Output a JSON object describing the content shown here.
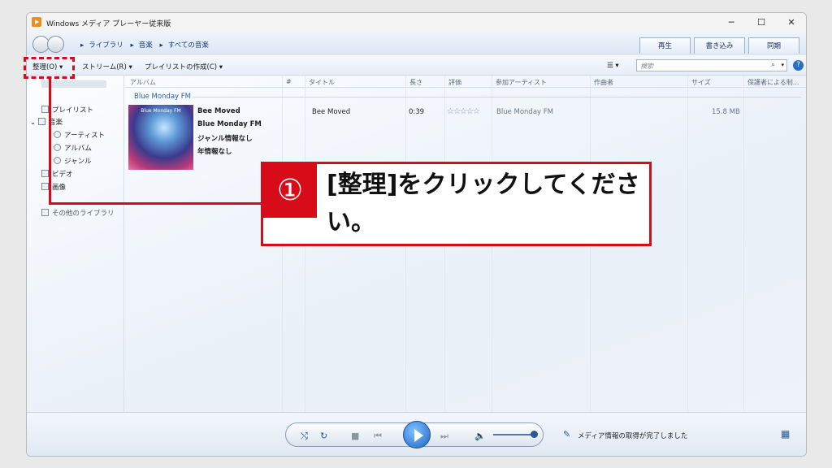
{
  "window": {
    "title": "Windows メディア プレーヤー従来版",
    "minimize": "─",
    "maximize": "☐",
    "close": "✕"
  },
  "breadcrumb": [
    "ライブラリ",
    "音楽",
    "すべての音楽"
  ],
  "tabs": [
    "再生",
    "書き込み",
    "同期"
  ],
  "toolbar": {
    "organize": "整理(O)",
    "stream": "ストリーム(R)",
    "create_playlist": "プレイリストの作成(C)",
    "search_placeholder": "検索"
  },
  "nav": {
    "playlists": "プレイリスト",
    "music": "音楽",
    "artist": "アーティスト",
    "album": "アルバム",
    "genre": "ジャンル",
    "video": "ビデオ",
    "pictures": "画像",
    "other_libraries": "その他のライブラリ"
  },
  "columns": [
    "アルバム",
    "#",
    "タイトル",
    "長さ",
    "評価",
    "参加アーティスト",
    "作曲者",
    "サイズ",
    "保護者による制..."
  ],
  "group": "Blue Monday FM",
  "album": {
    "art_text": "Blue Monday FM",
    "title": "Bee Moved",
    "artist": "Blue Monday FM",
    "genre": "ジャンル情報なし",
    "year": "年情報なし"
  },
  "track": {
    "title": "Bee Moved",
    "length": "0:39",
    "rating": "☆☆☆☆☆",
    "artist": "Blue Monday FM",
    "size": "15.8 MB"
  },
  "player": {
    "status": "メディア情報の取得が完了しました"
  },
  "callout": {
    "number": "①",
    "text": "[整理]をクリックしてください。"
  },
  "accent": "#d80c18"
}
